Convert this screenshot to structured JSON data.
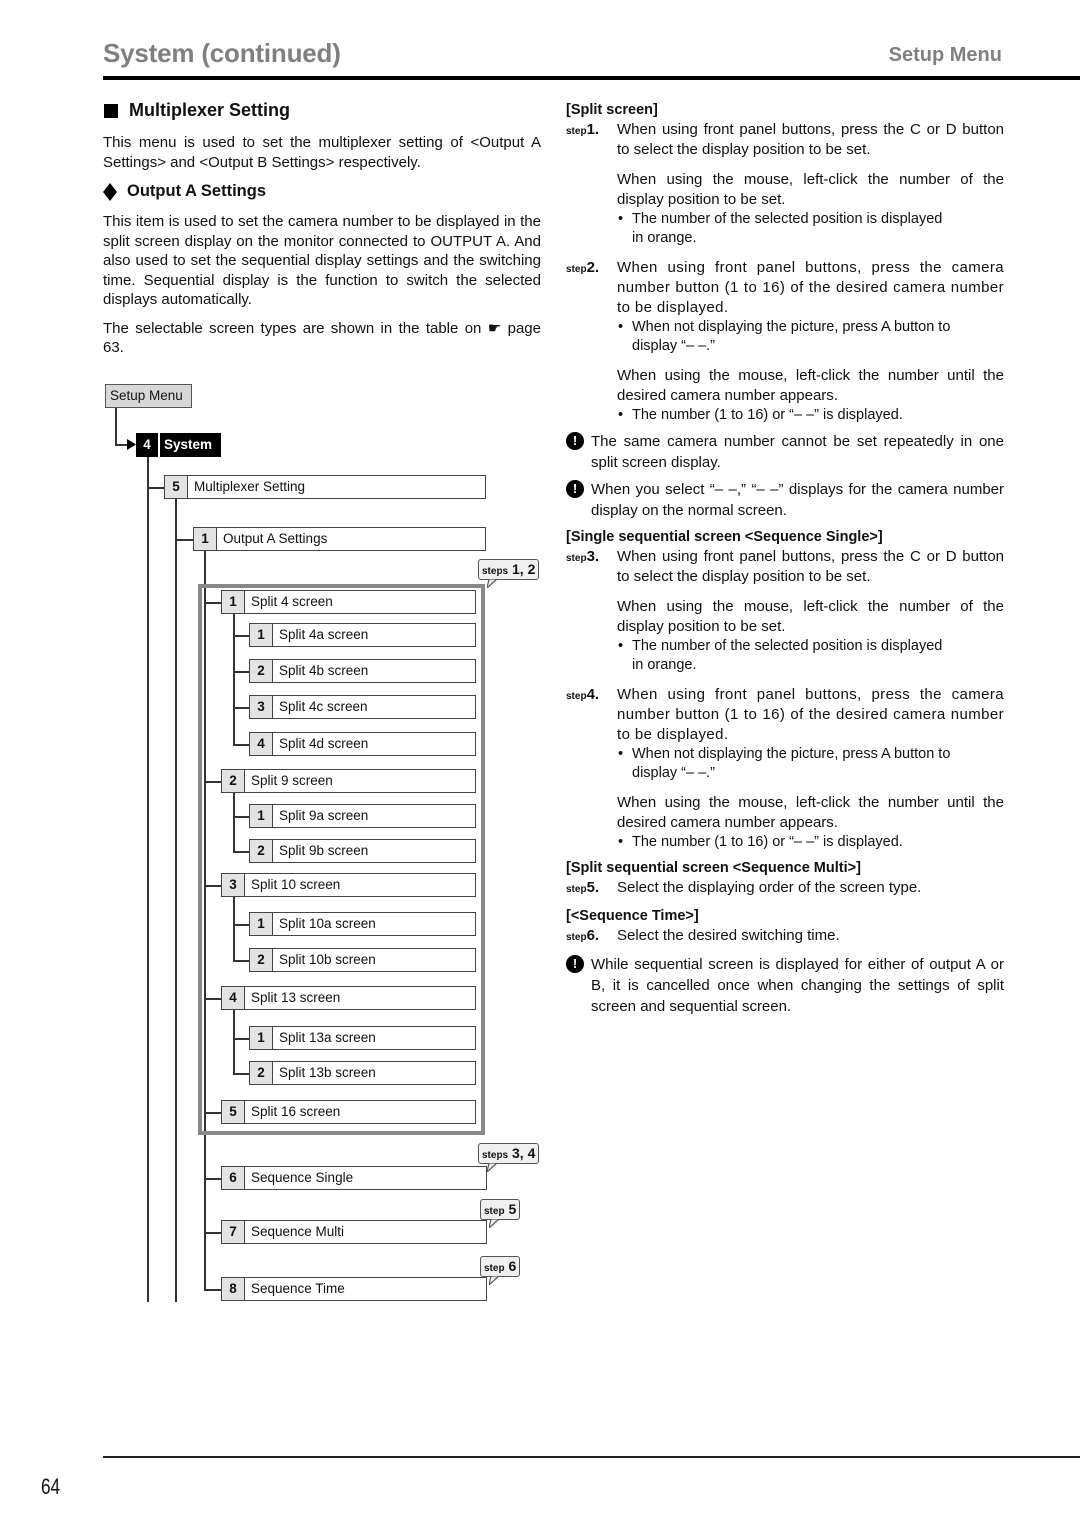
{
  "header": {
    "title": "System (continued)",
    "section": "Setup Menu"
  },
  "left": {
    "heading": "Multiplexer Setting",
    "heading_icon": "square-bullet-icon",
    "intro": "This menu is used to set the multiplexer setting of <Output A Settings> and <Output B Settings> respectively.",
    "subheading": "Output A Settings",
    "subheading_icon": "diamond-bullet-icon",
    "para1": "This item is used to set the camera number to be displayed in the split screen display on the monitor connected to OUTPUT A. And also used to set the sequential display settings and the switching time. Sequential display is the function to switch the selected displays automatically.",
    "para2_before": "The selectable screen types are shown in the table on",
    "para2_ref_icon": "pointing-hand-icon",
    "para2_after": "page 63."
  },
  "diagram": {
    "root": "Setup Menu",
    "system": {
      "num": "4",
      "label": "System"
    },
    "multiplexer": {
      "num": "5",
      "label": "Multiplexer Setting"
    },
    "output_a": {
      "num": "1",
      "label": "Output A Settings"
    },
    "items": [
      {
        "num": "1",
        "label": "Split 4 screen",
        "level": 1
      },
      {
        "num": "1",
        "label": "Split 4a screen",
        "level": 2
      },
      {
        "num": "2",
        "label": "Split 4b screen",
        "level": 2
      },
      {
        "num": "3",
        "label": "Split 4c screen",
        "level": 2
      },
      {
        "num": "4",
        "label": "Split 4d screen",
        "level": 2
      },
      {
        "num": "2",
        "label": "Split 9 screen",
        "level": 1
      },
      {
        "num": "1",
        "label": "Split 9a screen",
        "level": 2
      },
      {
        "num": "2",
        "label": "Split 9b screen",
        "level": 2
      },
      {
        "num": "3",
        "label": "Split 10 screen",
        "level": 1
      },
      {
        "num": "1",
        "label": "Split 10a screen",
        "level": 2
      },
      {
        "num": "2",
        "label": "Split 10b screen",
        "level": 2
      },
      {
        "num": "4",
        "label": "Split 13 screen",
        "level": 1
      },
      {
        "num": "1",
        "label": "Split 13a screen",
        "level": 2
      },
      {
        "num": "2",
        "label": "Split 13b screen",
        "level": 2
      },
      {
        "num": "5",
        "label": "Split 16 screen",
        "level": 1
      },
      {
        "num": "6",
        "label": "Sequence Single",
        "level": 1
      },
      {
        "num": "7",
        "label": "Sequence Multi",
        "level": 1
      },
      {
        "num": "8",
        "label": "Sequence Time",
        "level": 1
      }
    ],
    "callouts": [
      {
        "prefix": "steps",
        "value": "1, 2"
      },
      {
        "prefix": "steps",
        "value": "3, 4"
      },
      {
        "prefix": "step",
        "value": "5"
      },
      {
        "prefix": "step",
        "value": "6"
      }
    ]
  },
  "right": {
    "split_screen": {
      "title": "[Split screen]",
      "step1": {
        "prefix": "step",
        "num": "1.",
        "text": "When using front panel buttons, press the C or D button to select the display position to be set.",
        "mouse": "When using the mouse, left-click the number of the display position to be set.",
        "bullet": "The number of the selected position is displayed in orange."
      },
      "step2": {
        "prefix": "step",
        "num": "2.",
        "text": "When using front panel buttons, press the camera number button (1 to 16) of the desired camera number to be displayed.",
        "bullet1": "When not displaying the picture, press A button to display “– –.”",
        "mouse": "When using the mouse, left-click the number until the desired camera number appears.",
        "bullet2": "The number (1 to 16) or “– –” is displayed."
      },
      "note1": "The same camera number cannot be set repeatedly in one split screen display.",
      "note2": "When you select “– –,” “– –” displays for the camera number display on the normal screen."
    },
    "sequence_single": {
      "title": "[Single sequential screen <Sequence Single>]",
      "step3": {
        "prefix": "step",
        "num": "3.",
        "text": "When using front panel buttons, press the C or D button to select the display position to be set.",
        "mouse": "When using the mouse, left-click the number of the display position to be set.",
        "bullet": "The number of the selected position is displayed in orange."
      },
      "step4": {
        "prefix": "step",
        "num": "4.",
        "text": "When using front panel buttons, press the camera number button (1 to 16) of the desired camera number to be displayed.",
        "bullet1": "When not displaying the picture, press A button to display “– –.”",
        "mouse": "When using the mouse, left-click the number until the desired camera number appears.",
        "bullet2": "The number (1 to 16) or “– –” is displayed."
      }
    },
    "sequence_multi": {
      "title": "[Split sequential screen <Sequence Multi>]",
      "step5": {
        "prefix": "step",
        "num": "5.",
        "text": "Select the displaying order of the screen type."
      }
    },
    "sequence_time": {
      "title": "[<Sequence Time>]",
      "step6": {
        "prefix": "step",
        "num": "6.",
        "text": "Select the desired switching time."
      },
      "note": "While sequential screen is displayed for either of output A or B, it is cancelled once when changing the settings of split screen and sequential screen."
    },
    "note_icon": "exclamation-circle-icon"
  },
  "footer": {
    "page_number": "64"
  }
}
